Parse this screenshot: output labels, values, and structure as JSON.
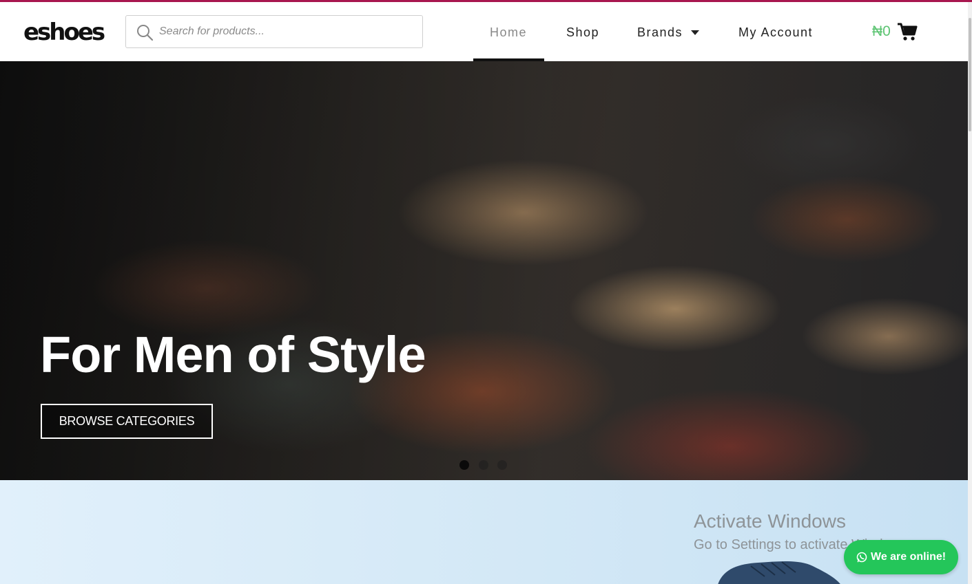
{
  "brand": {
    "logo_text": "eshoes",
    "accent": "#a8174e"
  },
  "search": {
    "placeholder": "Search for products...",
    "icon": "search-icon"
  },
  "nav": {
    "items": [
      {
        "label": "Home",
        "active": true
      },
      {
        "label": "Shop"
      },
      {
        "label": "Brands",
        "icon": "chevron-down-icon"
      },
      {
        "label": "My Account"
      }
    ]
  },
  "cart": {
    "amount": "₦0",
    "icon": "cart-icon",
    "amount_color": "#5cc472"
  },
  "hero": {
    "title": "For Men of Style",
    "button_label": "BROWSE CATEGORIES",
    "slides_count": 3,
    "active_slide": 1
  },
  "watermark": {
    "title": "Activate Windows",
    "subtitle": "Go to Settings to activate Windows."
  },
  "chat": {
    "label": "We are online!",
    "icon": "whatsapp-icon",
    "color": "#24c65a"
  }
}
